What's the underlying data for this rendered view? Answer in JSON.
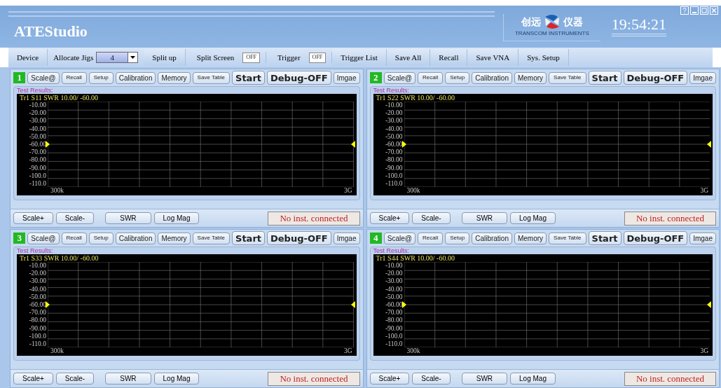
{
  "app": {
    "title": "ATEStudio",
    "logo_cn_left": "创远",
    "logo_cn_right": "仪器",
    "logo_en": "TRANSCOM INSTRUMENTS",
    "clock": "19:54:21"
  },
  "toolbar": [
    {
      "kind": "button",
      "label": "Device"
    },
    {
      "kind": "select",
      "label": "Allocate Jigs",
      "value": "4"
    },
    {
      "kind": "button",
      "label": "Split up"
    },
    {
      "kind": "toggle",
      "label": "Split Screen",
      "toggle_text": "OFF",
      "on": false
    },
    {
      "kind": "toggle",
      "label": "Trigger",
      "toggle_text": "OFF",
      "on": false
    },
    {
      "kind": "button",
      "label": "Trigger List"
    },
    {
      "kind": "button",
      "label": "Save All"
    },
    {
      "kind": "button",
      "label": "Recall"
    },
    {
      "kind": "button",
      "label": "Save VNA"
    },
    {
      "kind": "button",
      "label": "Sys. Setup"
    }
  ],
  "panels": [
    {
      "number": "1",
      "buttons": [
        {
          "kind": "small",
          "label": "Scale@"
        },
        {
          "kind": "tiny",
          "label": "Recall"
        },
        {
          "kind": "tiny",
          "label": "Setup"
        },
        {
          "kind": "small",
          "label": "Calibration"
        },
        {
          "kind": "small",
          "label": "Memory"
        },
        {
          "kind": "tiny",
          "label": "Save Table"
        },
        {
          "kind": "large",
          "label": "Start"
        },
        {
          "kind": "large",
          "label": "Debug-OFF"
        },
        {
          "kind": "small",
          "label": "Imgae"
        }
      ],
      "group_label": "Test Results:",
      "trace": "Tr1 S11 SWR 10.00/ -60.00",
      "y_labels": [
        "-10.00",
        "-20.00",
        "-30.00",
        "-40.00",
        "-50.00",
        "-60.00",
        "-70.00",
        "-80.00",
        "-90.00",
        "-100.0",
        "-110.0"
      ],
      "x_start": "300k",
      "x_end": "3G",
      "footer_buttons": [
        "Scale+",
        "Scale-",
        "SWR",
        "Log Mag"
      ],
      "status": "No inst. connected"
    },
    {
      "number": "2",
      "buttons": [
        {
          "kind": "small",
          "label": "Scale@"
        },
        {
          "kind": "tiny",
          "label": "Recall"
        },
        {
          "kind": "tiny",
          "label": "Setup"
        },
        {
          "kind": "small",
          "label": "Calibration"
        },
        {
          "kind": "small",
          "label": "Memory"
        },
        {
          "kind": "tiny",
          "label": "Save Table"
        },
        {
          "kind": "large",
          "label": "Start"
        },
        {
          "kind": "large",
          "label": "Debug-OFF"
        },
        {
          "kind": "small",
          "label": "Imgae"
        }
      ],
      "group_label": "Test Results:",
      "trace": "Tr1 S22 SWR 10.00/ -60.00",
      "y_labels": [
        "-10.00",
        "-20.00",
        "-30.00",
        "-40.00",
        "-50.00",
        "-60.00",
        "-70.00",
        "-80.00",
        "-90.00",
        "-100.0",
        "-110.0"
      ],
      "x_start": "300k",
      "x_end": "3G",
      "footer_buttons": [
        "Scale+",
        "Scale-",
        "SWR",
        "Log Mag"
      ],
      "status": "No inst. connected"
    },
    {
      "number": "3",
      "buttons": [
        {
          "kind": "small",
          "label": "Scale@"
        },
        {
          "kind": "tiny",
          "label": "Recall"
        },
        {
          "kind": "tiny",
          "label": "Setup"
        },
        {
          "kind": "small",
          "label": "Calibration"
        },
        {
          "kind": "small",
          "label": "Memory"
        },
        {
          "kind": "tiny",
          "label": "Save Table"
        },
        {
          "kind": "large",
          "label": "Start"
        },
        {
          "kind": "large",
          "label": "Debug-OFF"
        },
        {
          "kind": "small",
          "label": "Imgae"
        }
      ],
      "group_label": "Test Results:",
      "trace": "Tr1 S33 SWR 10.00/ -60.00",
      "y_labels": [
        "-10.00",
        "-20.00",
        "-30.00",
        "-40.00",
        "-50.00",
        "-60.00",
        "-70.00",
        "-80.00",
        "-90.00",
        "-100.0",
        "-110.0"
      ],
      "x_start": "300k",
      "x_end": "3G",
      "footer_buttons": [
        "Scale+",
        "Scale-",
        "SWR",
        "Log Mag"
      ],
      "status": "No inst. connected"
    },
    {
      "number": "4",
      "buttons": [
        {
          "kind": "small",
          "label": "Scale@"
        },
        {
          "kind": "tiny",
          "label": "Recall"
        },
        {
          "kind": "tiny",
          "label": "Setup"
        },
        {
          "kind": "small",
          "label": "Calibration"
        },
        {
          "kind": "small",
          "label": "Memory"
        },
        {
          "kind": "tiny",
          "label": "Save Table"
        },
        {
          "kind": "large",
          "label": "Start"
        },
        {
          "kind": "large",
          "label": "Debug-OFF"
        },
        {
          "kind": "small",
          "label": "Imgae"
        }
      ],
      "group_label": "Test Results:",
      "trace": "Tr1 S44 SWR 10.00/ -60.00",
      "y_labels": [
        "-10.00",
        "-20.00",
        "-30.00",
        "-40.00",
        "-50.00",
        "-60.00",
        "-70.00",
        "-80.00",
        "-90.00",
        "-100.0",
        "-110.0"
      ],
      "x_start": "300k",
      "x_end": "3G",
      "footer_buttons": [
        "Scale+",
        "Scale-",
        "SWR",
        "Log Mag"
      ],
      "status": "No inst. connected"
    }
  ]
}
